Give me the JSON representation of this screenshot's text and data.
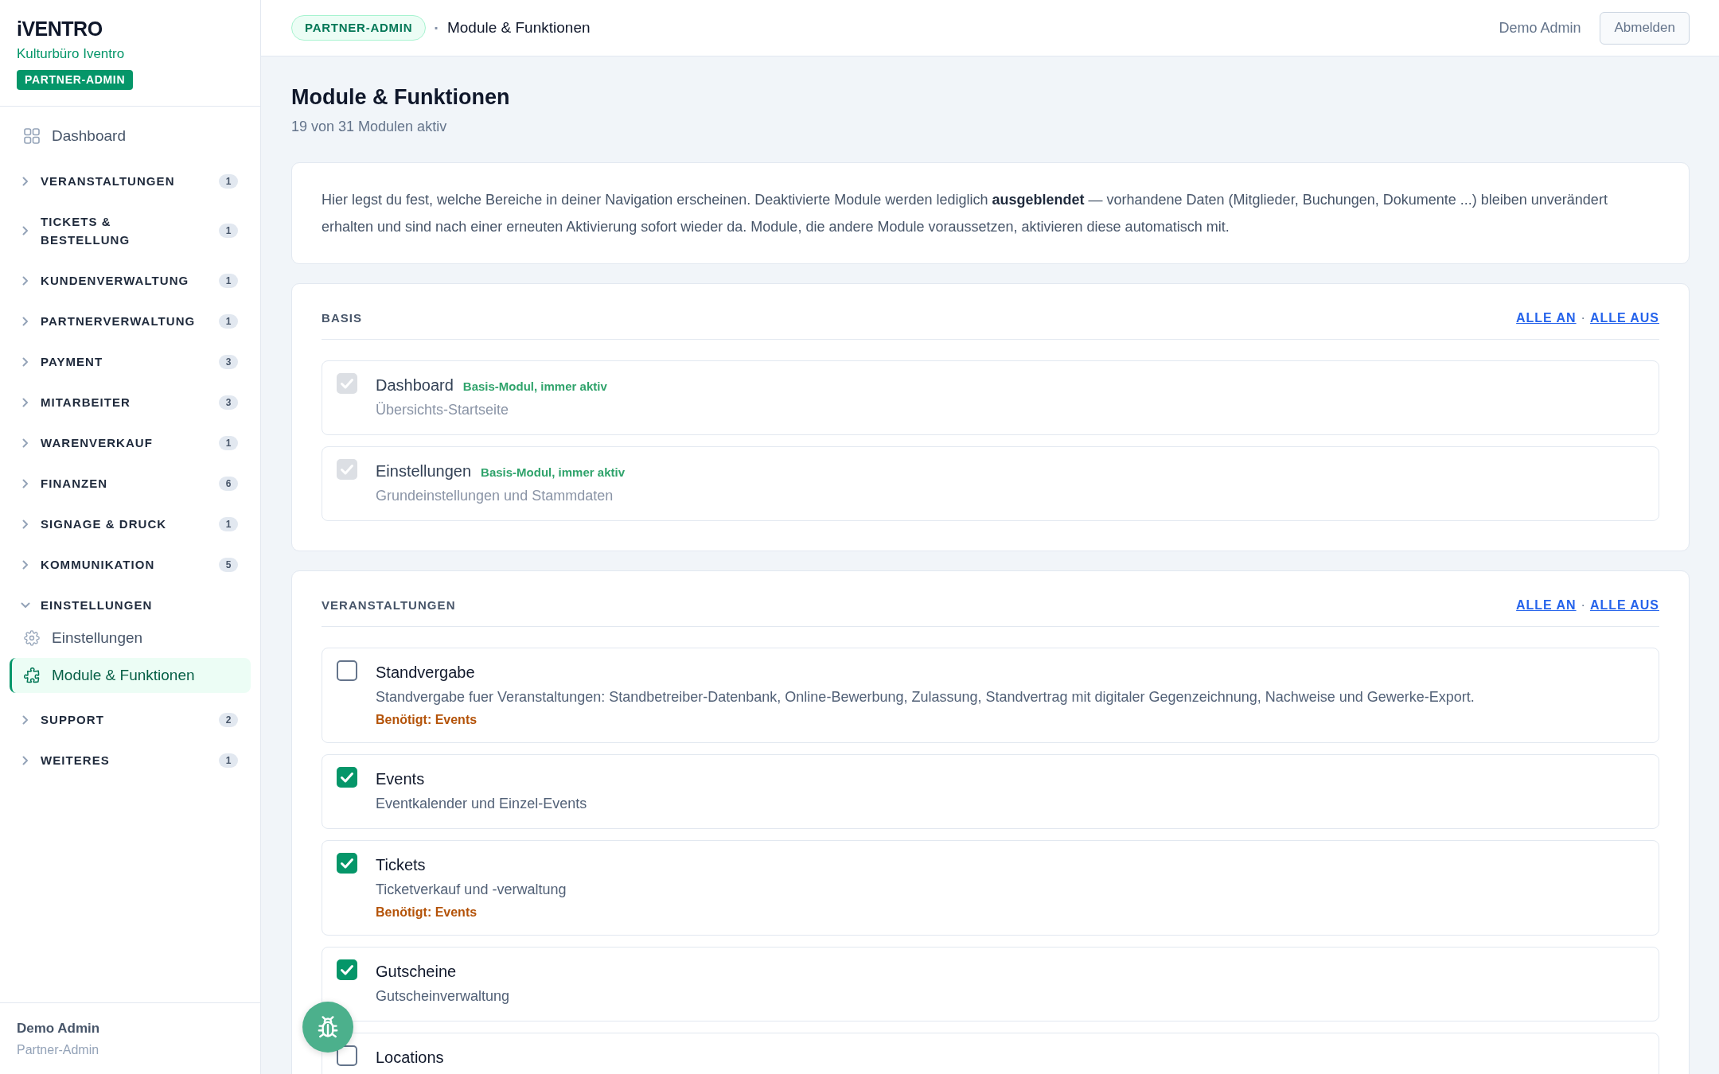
{
  "sidebar": {
    "brand": "iVENTRO",
    "organization": "Kulturbüro Iventro",
    "role_badge": "PARTNER-ADMIN",
    "items": [
      {
        "kind": "link",
        "label": "Dashboard",
        "selected": false
      },
      {
        "kind": "group",
        "label": "VERANSTALTUNGEN",
        "count": "1",
        "expanded": false
      },
      {
        "kind": "group",
        "label": "TICKETS & BESTELLUNG",
        "count": "1",
        "expanded": false
      },
      {
        "kind": "group",
        "label": "KUNDENVERWALTUNG",
        "count": "1",
        "expanded": false
      },
      {
        "kind": "group",
        "label": "PARTNERVERWALTUNG",
        "count": "1",
        "expanded": false
      },
      {
        "kind": "group",
        "label": "PAYMENT",
        "count": "3",
        "expanded": false
      },
      {
        "kind": "group",
        "label": "MITARBEITER",
        "count": "3",
        "expanded": false
      },
      {
        "kind": "group",
        "label": "WARENVERKAUF",
        "count": "1",
        "expanded": false
      },
      {
        "kind": "group",
        "label": "FINANZEN",
        "count": "6",
        "expanded": false
      },
      {
        "kind": "group",
        "label": "SIGNAGE & DRUCK",
        "count": "1",
        "expanded": false
      },
      {
        "kind": "group",
        "label": "KOMMUNIKATION",
        "count": "5",
        "expanded": false
      },
      {
        "kind": "group",
        "label": "EINSTELLUNGEN",
        "expanded": true,
        "children": [
          {
            "label": "Einstellungen",
            "selected": false
          },
          {
            "label": "Module & Funktionen",
            "selected": true
          }
        ]
      },
      {
        "kind": "group",
        "label": "SUPPORT",
        "count": "2",
        "expanded": false
      },
      {
        "kind": "group",
        "label": "WEITERES",
        "count": "1",
        "expanded": false
      }
    ],
    "user": {
      "name": "Demo Admin",
      "role": "Partner-Admin"
    }
  },
  "header": {
    "role_badge": "PARTNER-ADMIN",
    "separator": "·",
    "breadcrumb": "Module & Funktionen",
    "user": "Demo Admin",
    "logout_button": "Abmelden"
  },
  "page": {
    "title": "Module & Funktionen",
    "subtitle": "19 von 31 Modulen aktiv"
  },
  "info": "Hier legst du fest, welche Bereiche in deiner Navigation erscheinen. Deaktivierte Module werden lediglich **ausgeblendet** — vorhandene Daten (Mitglieder, Buchungen, Dokumente ...) bleiben unverändert erhalten und sind nach einer erneuten Aktivierung sofort wieder da. Module, die andere Module voraussetzen, aktivieren diese automatisch mit.",
  "sections": [
    {
      "title": "BASIS",
      "all_on": "ALLE AN",
      "separator": "·",
      "all_off": "ALLE AUS",
      "modules": [
        {
          "name": "Dashboard",
          "tag": "Basis-Modul, immer aktiv",
          "description": "Übersichts-Startseite",
          "checked": true,
          "disabled": true
        },
        {
          "name": "Einstellungen",
          "tag": "Basis-Modul, immer aktiv",
          "description": "Grundeinstellungen und Stammdaten",
          "checked": true,
          "disabled": true
        }
      ]
    },
    {
      "title": "VERANSTALTUNGEN",
      "all_on": "ALLE AN",
      "separator": "·",
      "all_off": "ALLE AUS",
      "modules": [
        {
          "name": "Standvergabe",
          "description": "Standvergabe fuer Veranstaltungen: Standbetreiber-Datenbank, Online-Bewerbung, Zulassung, Standvertrag mit digitaler Gegenzeichnung, Nachweise und Gewerke-Export.",
          "requires": "Benötigt: Events",
          "checked": false,
          "disabled": false
        },
        {
          "name": "Events",
          "description": "Eventkalender und Einzel-Events",
          "checked": true,
          "disabled": false
        },
        {
          "name": "Tickets",
          "description": "Ticketverkauf und -verwaltung",
          "requires": "Benötigt: Events",
          "checked": true,
          "disabled": false
        },
        {
          "name": "Gutscheine",
          "description": "Gutscheinverwaltung",
          "checked": true,
          "disabled": false
        },
        {
          "name": "Locations",
          "checked": false,
          "disabled": false
        }
      ]
    }
  ]
}
